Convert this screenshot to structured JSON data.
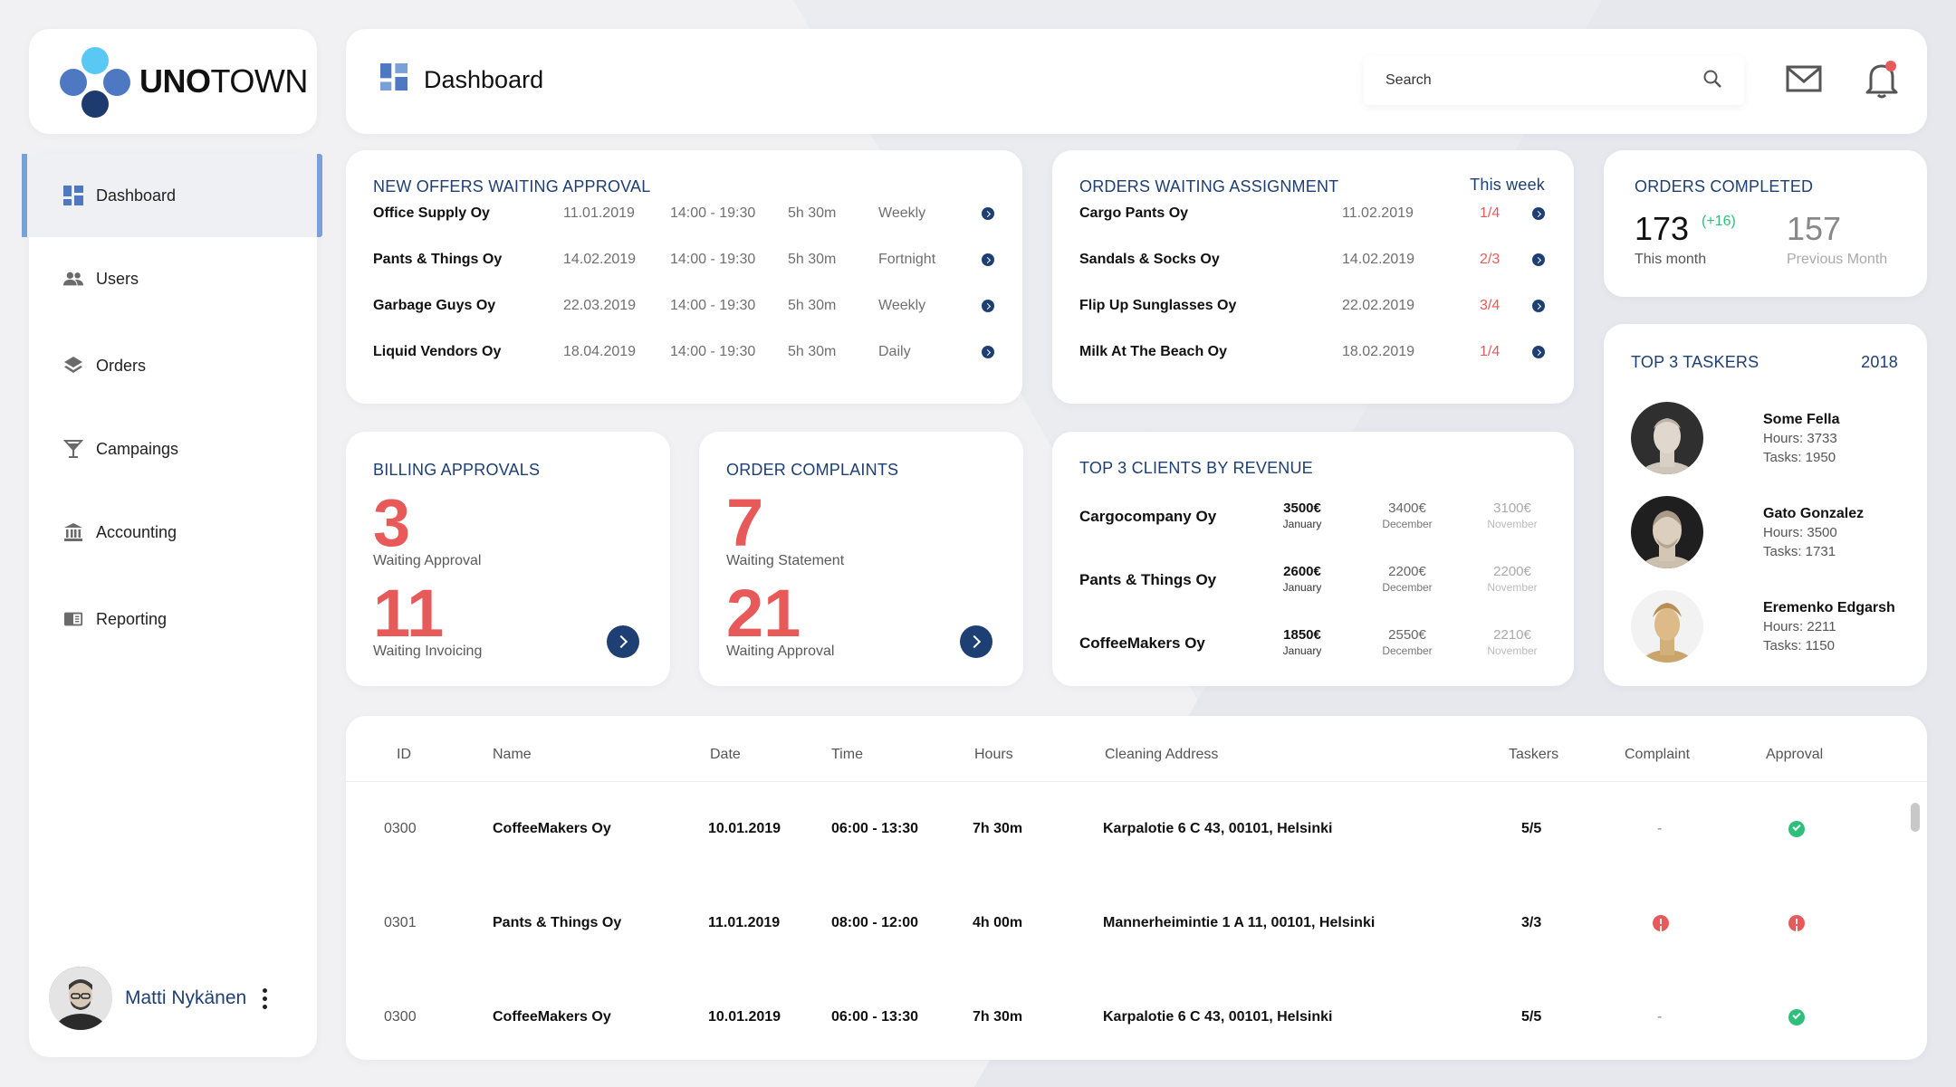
{
  "brand": {
    "name_bold": "UNO",
    "name_light": "TOWN"
  },
  "sidebar": {
    "items": [
      {
        "label": "Dashboard",
        "icon": "dashboard-icon",
        "active": true
      },
      {
        "label": "Users",
        "icon": "users-icon"
      },
      {
        "label": "Orders",
        "icon": "layers-icon"
      },
      {
        "label": "Campaings",
        "icon": "cocktail-icon"
      },
      {
        "label": "Accounting",
        "icon": "bank-icon"
      },
      {
        "label": "Reporting",
        "icon": "book-icon"
      }
    ],
    "user": {
      "name": "Matti Nykänen"
    }
  },
  "header": {
    "title": "Dashboard",
    "search_placeholder": "Search"
  },
  "offers": {
    "title": "NEW OFFERS WAITING APPROVAL",
    "rows": [
      {
        "name": "Office Supply Oy",
        "date": "11.01.2019",
        "time": "14:00 - 19:30",
        "hours": "5h 30m",
        "freq": "Weekly"
      },
      {
        "name": "Pants & Things Oy",
        "date": "14.02.2019",
        "time": "14:00 - 19:30",
        "hours": "5h 30m",
        "freq": "Fortnight"
      },
      {
        "name": "Garbage Guys Oy",
        "date": "22.03.2019",
        "time": "14:00 - 19:30",
        "hours": "5h 30m",
        "freq": "Weekly"
      },
      {
        "name": "Liquid Vendors Oy",
        "date": "18.04.2019",
        "time": "14:00 - 19:30",
        "hours": "5h 30m",
        "freq": "Daily"
      }
    ]
  },
  "assign": {
    "title": "ORDERS WAITING ASSIGNMENT",
    "period": "This week",
    "rows": [
      {
        "name": "Cargo Pants Oy",
        "date": "11.02.2019",
        "count": "1/4"
      },
      {
        "name": "Sandals & Socks Oy",
        "date": "14.02.2019",
        "count": "2/3"
      },
      {
        "name": "Flip Up Sunglasses Oy",
        "date": "22.02.2019",
        "count": "3/4"
      },
      {
        "name": "Milk At The Beach Oy",
        "date": "18.02.2019",
        "count": "1/4"
      }
    ]
  },
  "completed": {
    "title": "ORDERS COMPLETED",
    "this_value": "173",
    "delta": "(+16)",
    "this_label": "This month",
    "prev_value": "157",
    "prev_label": "Previous Month"
  },
  "taskers": {
    "title": "TOP 3 TASKERS",
    "year": "2018",
    "items": [
      {
        "name": "Some Fella",
        "hours": "Hours: 3733",
        "tasks": "Tasks: 1950"
      },
      {
        "name": "Gato Gonzalez",
        "hours": "Hours: 3500",
        "tasks": "Tasks: 1731"
      },
      {
        "name": "Eremenko Edgarsh",
        "hours": "Hours: 2211",
        "tasks": "Tasks: 1150"
      }
    ]
  },
  "billing": {
    "title": "BILLING APPROVALS",
    "n1": "3",
    "l1": "Waiting Approval",
    "n2": "11",
    "l2": "Waiting Invoicing"
  },
  "complaints": {
    "title": "ORDER COMPLAINTS",
    "n1": "7",
    "l1": "Waiting Statement",
    "n2": "21",
    "l2": "Waiting Approval"
  },
  "clients": {
    "title": "TOP 3 CLIENTS BY REVENUE",
    "rows": [
      {
        "name": "Cargocompany Oy",
        "v1": "3500€",
        "m1": "January",
        "v2": "3400€",
        "m2": "December",
        "v3": "3100€",
        "m3": "November"
      },
      {
        "name": "Pants & Things Oy",
        "v1": "2600€",
        "m1": "January",
        "v2": "2200€",
        "m2": "December",
        "v3": "2200€",
        "m3": "November"
      },
      {
        "name": "CoffeeMakers Oy",
        "v1": "1850€",
        "m1": "January",
        "v2": "2550€",
        "m2": "December",
        "v3": "2210€",
        "m3": "November"
      }
    ]
  },
  "orders_table": {
    "headers": [
      "ID",
      "Name",
      "Date",
      "Time",
      "Hours",
      "Cleaning Address",
      "Taskers",
      "Complaint",
      "Approval"
    ],
    "rows": [
      {
        "id": "0300",
        "name": "CoffeeMakers Oy",
        "date": "10.01.2019",
        "time": "06:00 - 13:30",
        "hours": "7h 30m",
        "address": "Karpalotie 6 C 43, 00101, Helsinki",
        "taskers": "5/5",
        "complaint": "-",
        "approval": "ok"
      },
      {
        "id": "0301",
        "name": "Pants & Things Oy",
        "date": "11.01.2019",
        "time": "08:00 - 12:00",
        "hours": "4h 00m",
        "address": "Mannerheimintie 1 A 11, 00101, Helsinki",
        "taskers": "3/3",
        "complaint": "alert",
        "approval": "alert"
      },
      {
        "id": "0300",
        "name": "CoffeeMakers Oy",
        "date": "10.01.2019",
        "time": "06:00 - 13:30",
        "hours": "7h 30m",
        "address": "Karpalotie 6 C 43, 00101, Helsinki",
        "taskers": "5/5",
        "complaint": "-",
        "approval": "ok"
      }
    ]
  },
  "colors": {
    "accent": "#1e3f73",
    "alert": "#e85a5a",
    "ok": "#2ebf7a",
    "logo_light": "#5ac8f5",
    "logo_mid": "#4e78c2"
  }
}
